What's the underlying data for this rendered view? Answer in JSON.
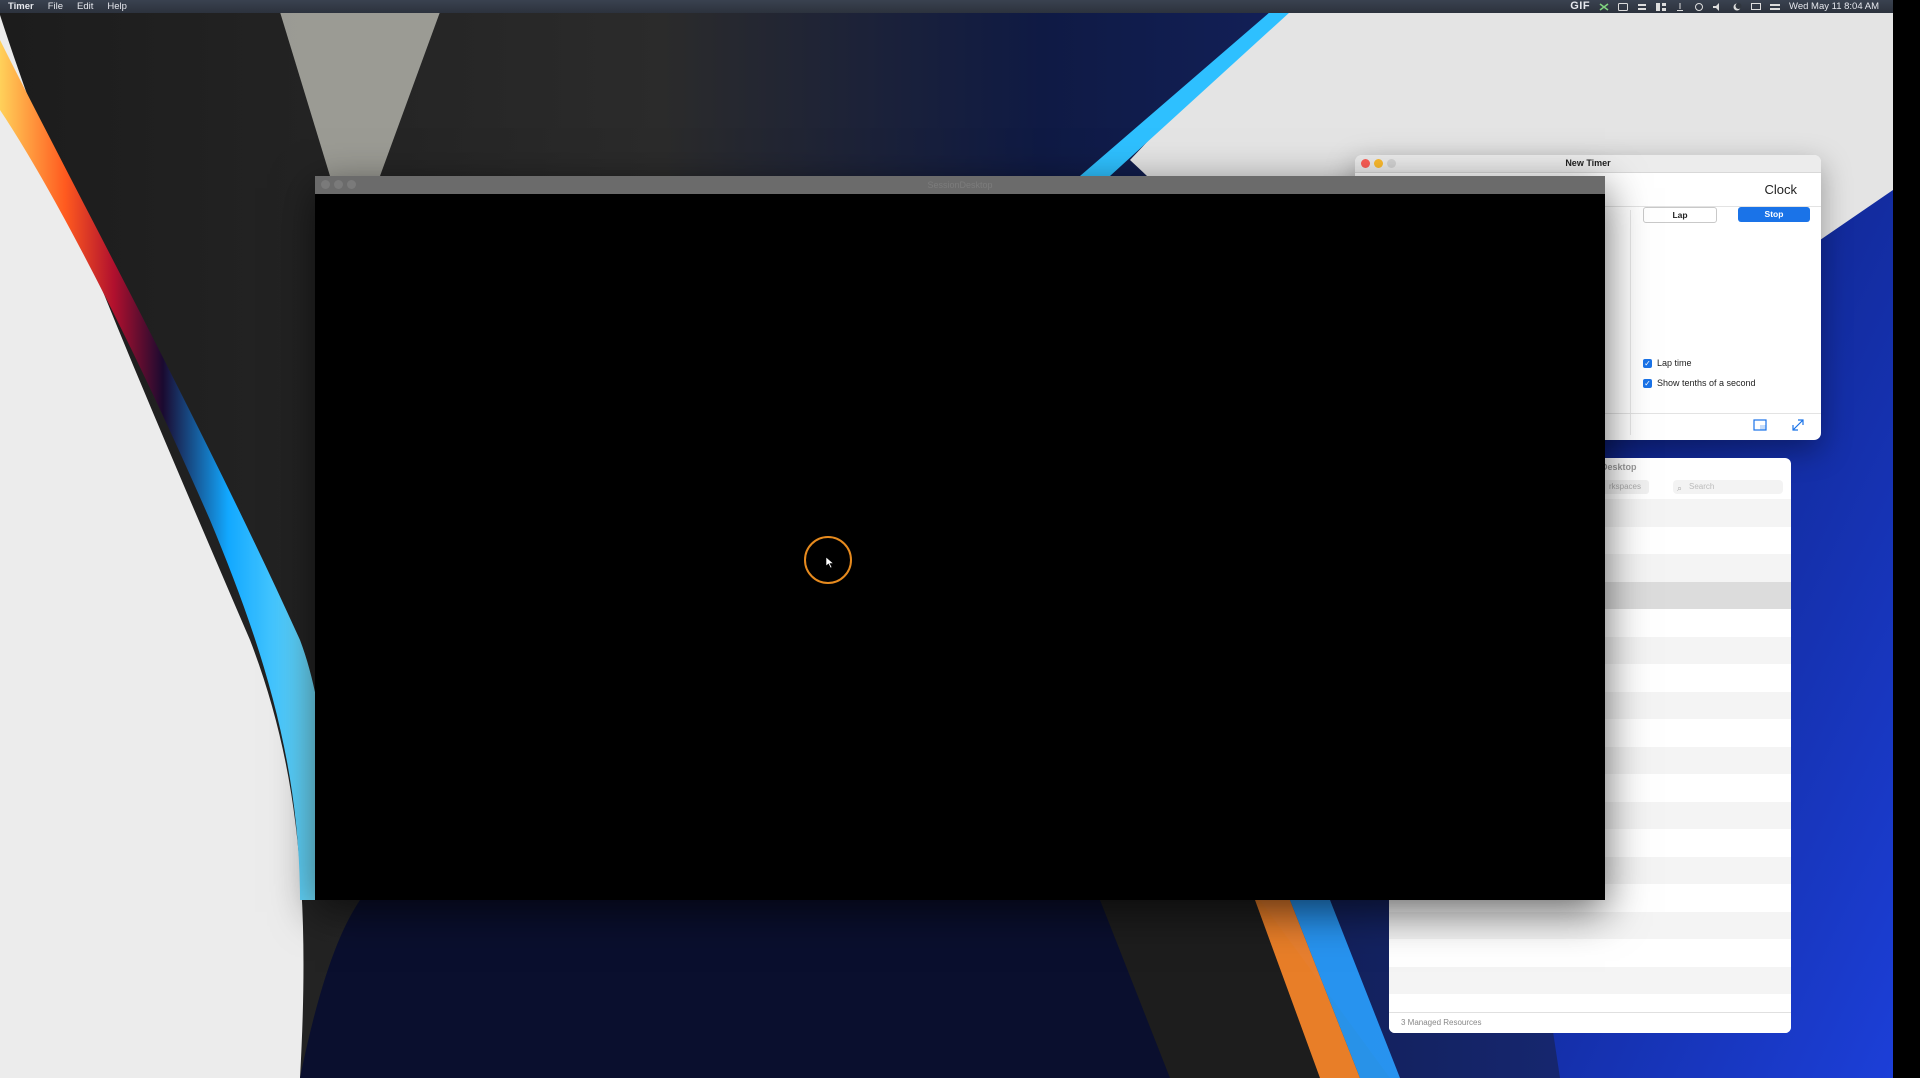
{
  "menubar": {
    "app_name": "Timer",
    "menus": [
      "File",
      "Edit",
      "Help"
    ],
    "gif_label": "GIF",
    "clock": "Wed May 11  8:04 AM"
  },
  "timer_window": {
    "title": "New Timer",
    "mode_label": "Clock",
    "lap_button": "Lap",
    "stop_button": "Stop",
    "options": [
      {
        "label": "Lap time",
        "checked": true
      },
      {
        "label": "Show tenths of a second",
        "checked": true
      }
    ]
  },
  "desktop_window": {
    "title": "Desktop",
    "tab_label": "rkspaces",
    "search_placeholder": "Search",
    "status": "3 Managed Resources",
    "selected_row": 3
  },
  "session_window": {
    "title": "SessionDesktop"
  },
  "colors": {
    "accent": "#1a73e8",
    "cursor_highlight": "#e68a1e",
    "close": "#fe5f57",
    "minimize": "#febc2e"
  }
}
